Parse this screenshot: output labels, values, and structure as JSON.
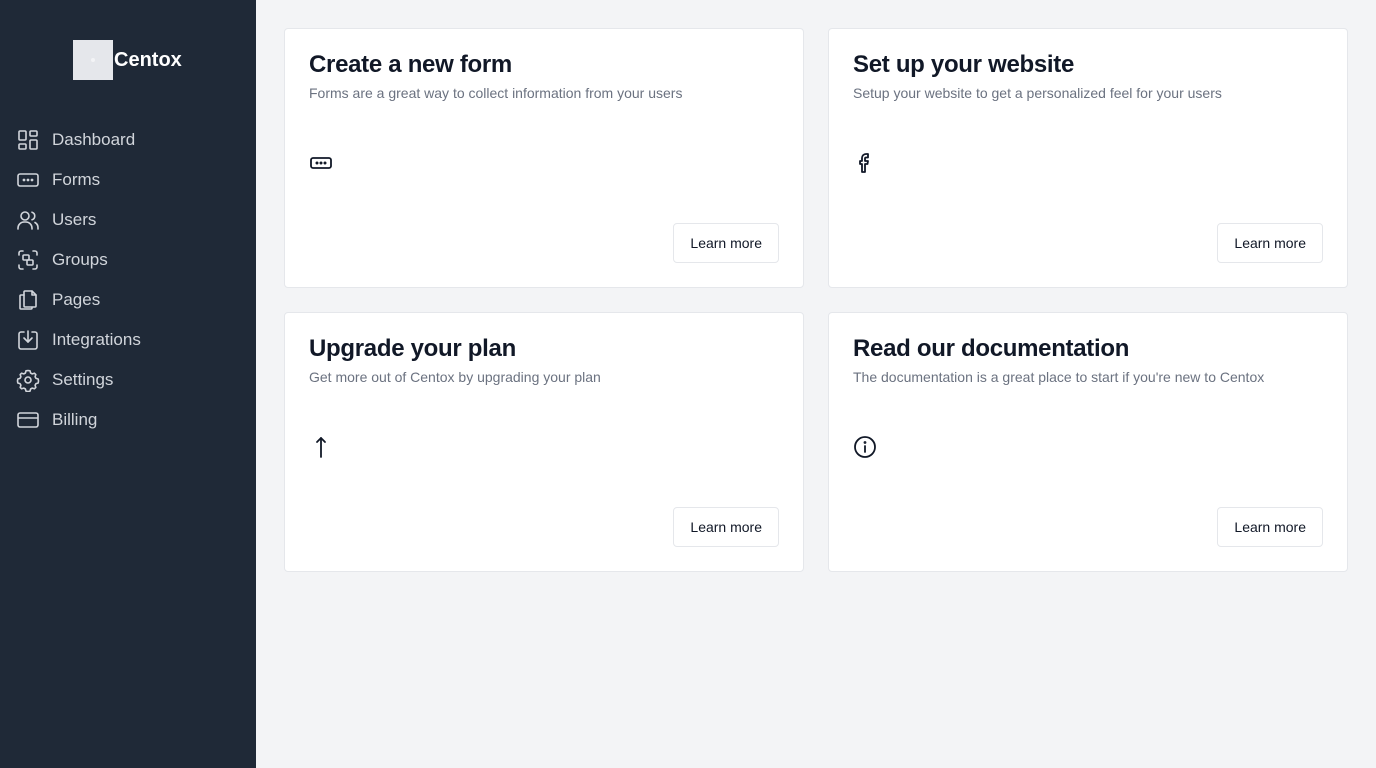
{
  "brand": {
    "name": "Centox"
  },
  "sidebar": {
    "items": [
      {
        "label": "Dashboard"
      },
      {
        "label": "Forms"
      },
      {
        "label": "Users"
      },
      {
        "label": "Groups"
      },
      {
        "label": "Pages"
      },
      {
        "label": "Integrations"
      },
      {
        "label": "Settings"
      },
      {
        "label": "Billing"
      }
    ]
  },
  "cards": [
    {
      "title": "Create a new form",
      "description": "Forms are a great way to collect information from your users",
      "icon": "form-input-icon",
      "button_label": "Learn more"
    },
    {
      "title": "Set up your website",
      "description": "Setup your website to get a personalized feel for your users",
      "icon": "facebook-icon",
      "button_label": "Learn more"
    },
    {
      "title": "Upgrade your plan",
      "description": "Get more out of Centox by upgrading your plan",
      "icon": "arrow-up-icon",
      "button_label": "Learn more"
    },
    {
      "title": "Read our documentation",
      "description": "The documentation is a great place to start if you're new to Centox",
      "icon": "info-icon",
      "button_label": "Learn more"
    }
  ],
  "colors": {
    "sidebar_bg": "#1f2937",
    "page_bg": "#f3f4f6",
    "nav_text": "#d1d5db",
    "title_text": "#111827",
    "desc_text": "#6b7280"
  }
}
